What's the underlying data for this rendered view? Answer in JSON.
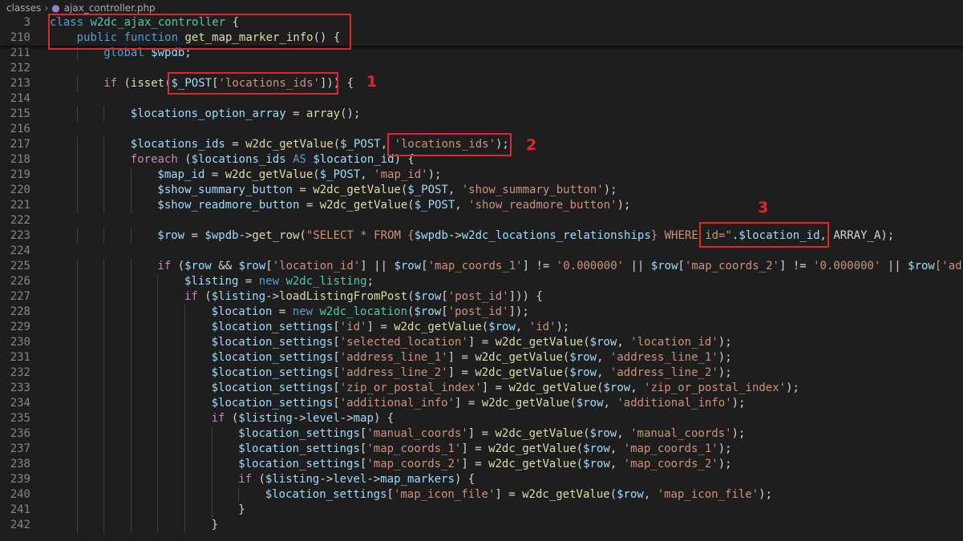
{
  "breadcrumb": {
    "folder": "classes",
    "file": "ajax_controller.php"
  },
  "lines": [
    {
      "n": "3",
      "indent": 0,
      "t": [
        [
          "class ",
          "k"
        ],
        [
          "w2dc_ajax_controller",
          "c"
        ],
        [
          " {",
          "p"
        ]
      ]
    },
    {
      "n": "210",
      "indent": 1,
      "t": [
        [
          "public ",
          "k"
        ],
        [
          "function ",
          "k"
        ],
        [
          "get_map_marker_info",
          "fn"
        ],
        [
          "() {",
          "p"
        ]
      ]
    },
    {
      "n": "211",
      "indent": 2,
      "t": [
        [
          "global ",
          "k"
        ],
        [
          "$wpdb",
          "v"
        ],
        [
          ";",
          "p"
        ]
      ]
    },
    {
      "n": "212",
      "indent": 0,
      "t": []
    },
    {
      "n": "213",
      "indent": 2,
      "t": [
        [
          "if ",
          "kw"
        ],
        [
          "(",
          "p"
        ],
        [
          "isset",
          "fn"
        ],
        [
          "(",
          "p"
        ],
        [
          "$_POST",
          "v"
        ],
        [
          "[",
          "p"
        ],
        [
          "'locations_ids'",
          "s"
        ],
        [
          "])) {",
          "p"
        ]
      ]
    },
    {
      "n": "214",
      "indent": 0,
      "t": []
    },
    {
      "n": "215",
      "indent": 3,
      "t": [
        [
          "$locations_option_array",
          "v"
        ],
        [
          " = ",
          "p"
        ],
        [
          "array",
          "fn"
        ],
        [
          "();",
          "p"
        ]
      ]
    },
    {
      "n": "216",
      "indent": 0,
      "t": []
    },
    {
      "n": "217",
      "indent": 3,
      "t": [
        [
          "$locations_ids",
          "v"
        ],
        [
          " = ",
          "p"
        ],
        [
          "w2dc_getValue",
          "fn"
        ],
        [
          "(",
          "p"
        ],
        [
          "$_POST",
          "v"
        ],
        [
          ", ",
          "p"
        ],
        [
          "'locations_ids'",
          "s"
        ],
        [
          ");",
          "p"
        ]
      ]
    },
    {
      "n": "218",
      "indent": 3,
      "t": [
        [
          "foreach ",
          "kw"
        ],
        [
          "(",
          "p"
        ],
        [
          "$locations_ids",
          "v"
        ],
        [
          " AS ",
          "k"
        ],
        [
          "$location_id",
          "v"
        ],
        [
          ") {",
          "p"
        ]
      ]
    },
    {
      "n": "219",
      "indent": 4,
      "t": [
        [
          "$map_id",
          "v"
        ],
        [
          " = ",
          "p"
        ],
        [
          "w2dc_getValue",
          "fn"
        ],
        [
          "(",
          "p"
        ],
        [
          "$_POST",
          "v"
        ],
        [
          ", ",
          "p"
        ],
        [
          "'map_id'",
          "s"
        ],
        [
          ");",
          "p"
        ]
      ]
    },
    {
      "n": "220",
      "indent": 4,
      "t": [
        [
          "$show_summary_button",
          "v"
        ],
        [
          " = ",
          "p"
        ],
        [
          "w2dc_getValue",
          "fn"
        ],
        [
          "(",
          "p"
        ],
        [
          "$_POST",
          "v"
        ],
        [
          ", ",
          "p"
        ],
        [
          "'show_summary_button'",
          "s"
        ],
        [
          ");",
          "p"
        ]
      ]
    },
    {
      "n": "221",
      "indent": 4,
      "t": [
        [
          "$show_readmore_button",
          "v"
        ],
        [
          " = ",
          "p"
        ],
        [
          "w2dc_getValue",
          "fn"
        ],
        [
          "(",
          "p"
        ],
        [
          "$_POST",
          "v"
        ],
        [
          ", ",
          "p"
        ],
        [
          "'show_readmore_button'",
          "s"
        ],
        [
          ");",
          "p"
        ]
      ]
    },
    {
      "n": "222",
      "indent": 0,
      "t": []
    },
    {
      "n": "223",
      "indent": 4,
      "t": [
        [
          "$row",
          "v"
        ],
        [
          " = ",
          "p"
        ],
        [
          "$wpdb",
          "v"
        ],
        [
          "->",
          "p"
        ],
        [
          "get_row",
          "fn"
        ],
        [
          "(",
          "p"
        ],
        [
          "\"SELECT * FROM {",
          "s"
        ],
        [
          "$wpdb",
          "v"
        ],
        [
          "->",
          "p"
        ],
        [
          "w2dc_locations_relationships",
          "v"
        ],
        [
          "} WHERE ",
          "s"
        ],
        [
          "id=\"",
          "s"
        ],
        [
          ".",
          "p"
        ],
        [
          "$location_id",
          "v"
        ],
        [
          ", ",
          "p"
        ],
        [
          "ARRAY_A",
          "p"
        ],
        [
          ");",
          "p"
        ]
      ]
    },
    {
      "n": "224",
      "indent": 0,
      "t": []
    },
    {
      "n": "225",
      "indent": 4,
      "t": [
        [
          "if ",
          "kw"
        ],
        [
          "(",
          "p"
        ],
        [
          "$row",
          "v"
        ],
        [
          " && ",
          "p"
        ],
        [
          "$row",
          "v"
        ],
        [
          "[",
          "p"
        ],
        [
          "'location_id'",
          "s"
        ],
        [
          "] || ",
          "p"
        ],
        [
          "$row",
          "v"
        ],
        [
          "[",
          "p"
        ],
        [
          "'map_coords_1'",
          "s"
        ],
        [
          "] != ",
          "p"
        ],
        [
          "'0.000000'",
          "s"
        ],
        [
          " || ",
          "p"
        ],
        [
          "$row",
          "v"
        ],
        [
          "[",
          "p"
        ],
        [
          "'map_coords_2'",
          "s"
        ],
        [
          "] != ",
          "p"
        ],
        [
          "'0.000000'",
          "s"
        ],
        [
          " || ",
          "p"
        ],
        [
          "$row",
          "v"
        ],
        [
          "['ad",
          "s"
        ]
      ]
    },
    {
      "n": "226",
      "indent": 5,
      "t": [
        [
          "$listing",
          "v"
        ],
        [
          " = ",
          "p"
        ],
        [
          "new ",
          "k"
        ],
        [
          "w2dc_listing",
          "c"
        ],
        [
          ";",
          "p"
        ]
      ]
    },
    {
      "n": "227",
      "indent": 5,
      "t": [
        [
          "if ",
          "kw"
        ],
        [
          "(",
          "p"
        ],
        [
          "$listing",
          "v"
        ],
        [
          "->",
          "p"
        ],
        [
          "loadListingFromPost",
          "fn"
        ],
        [
          "(",
          "p"
        ],
        [
          "$row",
          "v"
        ],
        [
          "[",
          "p"
        ],
        [
          "'post_id'",
          "s"
        ],
        [
          "])) {",
          "p"
        ]
      ]
    },
    {
      "n": "228",
      "indent": 6,
      "t": [
        [
          "$location",
          "v"
        ],
        [
          " = ",
          "p"
        ],
        [
          "new ",
          "k"
        ],
        [
          "w2dc_location",
          "c"
        ],
        [
          "(",
          "p"
        ],
        [
          "$row",
          "v"
        ],
        [
          "[",
          "p"
        ],
        [
          "'post_id'",
          "s"
        ],
        [
          "]);",
          "p"
        ]
      ]
    },
    {
      "n": "229",
      "indent": 6,
      "t": [
        [
          "$location_settings",
          "v"
        ],
        [
          "[",
          "p"
        ],
        [
          "'id'",
          "s"
        ],
        [
          "] = ",
          "p"
        ],
        [
          "w2dc_getValue",
          "fn"
        ],
        [
          "(",
          "p"
        ],
        [
          "$row",
          "v"
        ],
        [
          ", ",
          "p"
        ],
        [
          "'id'",
          "s"
        ],
        [
          ");",
          "p"
        ]
      ]
    },
    {
      "n": "230",
      "indent": 6,
      "t": [
        [
          "$location_settings",
          "v"
        ],
        [
          "[",
          "p"
        ],
        [
          "'selected_location'",
          "s"
        ],
        [
          "] = ",
          "p"
        ],
        [
          "w2dc_getValue",
          "fn"
        ],
        [
          "(",
          "p"
        ],
        [
          "$row",
          "v"
        ],
        [
          ", ",
          "p"
        ],
        [
          "'location_id'",
          "s"
        ],
        [
          ");",
          "p"
        ]
      ]
    },
    {
      "n": "231",
      "indent": 6,
      "t": [
        [
          "$location_settings",
          "v"
        ],
        [
          "[",
          "p"
        ],
        [
          "'address_line_1'",
          "s"
        ],
        [
          "] = ",
          "p"
        ],
        [
          "w2dc_getValue",
          "fn"
        ],
        [
          "(",
          "p"
        ],
        [
          "$row",
          "v"
        ],
        [
          ", ",
          "p"
        ],
        [
          "'address_line_1'",
          "s"
        ],
        [
          ");",
          "p"
        ]
      ]
    },
    {
      "n": "232",
      "indent": 6,
      "t": [
        [
          "$location_settings",
          "v"
        ],
        [
          "[",
          "p"
        ],
        [
          "'address_line_2'",
          "s"
        ],
        [
          "] = ",
          "p"
        ],
        [
          "w2dc_getValue",
          "fn"
        ],
        [
          "(",
          "p"
        ],
        [
          "$row",
          "v"
        ],
        [
          ", ",
          "p"
        ],
        [
          "'address_line_2'",
          "s"
        ],
        [
          ");",
          "p"
        ]
      ]
    },
    {
      "n": "233",
      "indent": 6,
      "t": [
        [
          "$location_settings",
          "v"
        ],
        [
          "[",
          "p"
        ],
        [
          "'zip_or_postal_index'",
          "s"
        ],
        [
          "] = ",
          "p"
        ],
        [
          "w2dc_getValue",
          "fn"
        ],
        [
          "(",
          "p"
        ],
        [
          "$row",
          "v"
        ],
        [
          ", ",
          "p"
        ],
        [
          "'zip_or_postal_index'",
          "s"
        ],
        [
          ");",
          "p"
        ]
      ]
    },
    {
      "n": "234",
      "indent": 6,
      "t": [
        [
          "$location_settings",
          "v"
        ],
        [
          "[",
          "p"
        ],
        [
          "'additional_info'",
          "s"
        ],
        [
          "] = ",
          "p"
        ],
        [
          "w2dc_getValue",
          "fn"
        ],
        [
          "(",
          "p"
        ],
        [
          "$row",
          "v"
        ],
        [
          ", ",
          "p"
        ],
        [
          "'additional_info'",
          "s"
        ],
        [
          ");",
          "p"
        ]
      ]
    },
    {
      "n": "235",
      "indent": 6,
      "t": [
        [
          "if ",
          "kw"
        ],
        [
          "(",
          "p"
        ],
        [
          "$listing",
          "v"
        ],
        [
          "->",
          "p"
        ],
        [
          "level",
          "v"
        ],
        [
          "->",
          "p"
        ],
        [
          "map",
          "v"
        ],
        [
          ") {",
          "p"
        ]
      ]
    },
    {
      "n": "236",
      "indent": 7,
      "t": [
        [
          "$location_settings",
          "v"
        ],
        [
          "[",
          "p"
        ],
        [
          "'manual_coords'",
          "s"
        ],
        [
          "] = ",
          "p"
        ],
        [
          "w2dc_getValue",
          "fn"
        ],
        [
          "(",
          "p"
        ],
        [
          "$row",
          "v"
        ],
        [
          ", ",
          "p"
        ],
        [
          "'manual_coords'",
          "s"
        ],
        [
          ");",
          "p"
        ]
      ]
    },
    {
      "n": "237",
      "indent": 7,
      "t": [
        [
          "$location_settings",
          "v"
        ],
        [
          "[",
          "p"
        ],
        [
          "'map_coords_1'",
          "s"
        ],
        [
          "] = ",
          "p"
        ],
        [
          "w2dc_getValue",
          "fn"
        ],
        [
          "(",
          "p"
        ],
        [
          "$row",
          "v"
        ],
        [
          ", ",
          "p"
        ],
        [
          "'map_coords_1'",
          "s"
        ],
        [
          ");",
          "p"
        ]
      ]
    },
    {
      "n": "238",
      "indent": 7,
      "t": [
        [
          "$location_settings",
          "v"
        ],
        [
          "[",
          "p"
        ],
        [
          "'map_coords_2'",
          "s"
        ],
        [
          "] = ",
          "p"
        ],
        [
          "w2dc_getValue",
          "fn"
        ],
        [
          "(",
          "p"
        ],
        [
          "$row",
          "v"
        ],
        [
          ", ",
          "p"
        ],
        [
          "'map_coords_2'",
          "s"
        ],
        [
          ");",
          "p"
        ]
      ]
    },
    {
      "n": "239",
      "indent": 7,
      "t": [
        [
          "if ",
          "kw"
        ],
        [
          "(",
          "p"
        ],
        [
          "$listing",
          "v"
        ],
        [
          "->",
          "p"
        ],
        [
          "level",
          "v"
        ],
        [
          "->",
          "p"
        ],
        [
          "map_markers",
          "v"
        ],
        [
          ") {",
          "p"
        ]
      ]
    },
    {
      "n": "240",
      "indent": 8,
      "t": [
        [
          "$location_settings",
          "v"
        ],
        [
          "[",
          "p"
        ],
        [
          "'map_icon_file'",
          "s"
        ],
        [
          "] = ",
          "p"
        ],
        [
          "w2dc_getValue",
          "fn"
        ],
        [
          "(",
          "p"
        ],
        [
          "$row",
          "v"
        ],
        [
          ", ",
          "p"
        ],
        [
          "'map_icon_file'",
          "s"
        ],
        [
          ");",
          "p"
        ]
      ]
    },
    {
      "n": "241",
      "indent": 7,
      "t": [
        [
          "}",
          "p"
        ]
      ]
    },
    {
      "n": "242",
      "indent": 6,
      "t": [
        [
          "}",
          "p"
        ]
      ]
    }
  ],
  "annotations": [
    "1",
    "2",
    "3"
  ],
  "colors": {
    "annotation": "#e3262d",
    "background": "#1e1e1e",
    "keyword": "#569cd6",
    "control": "#c586c0",
    "function": "#dcdcaa",
    "variable": "#9cdcfe",
    "string": "#ce9178",
    "class": "#4ec9b0"
  }
}
